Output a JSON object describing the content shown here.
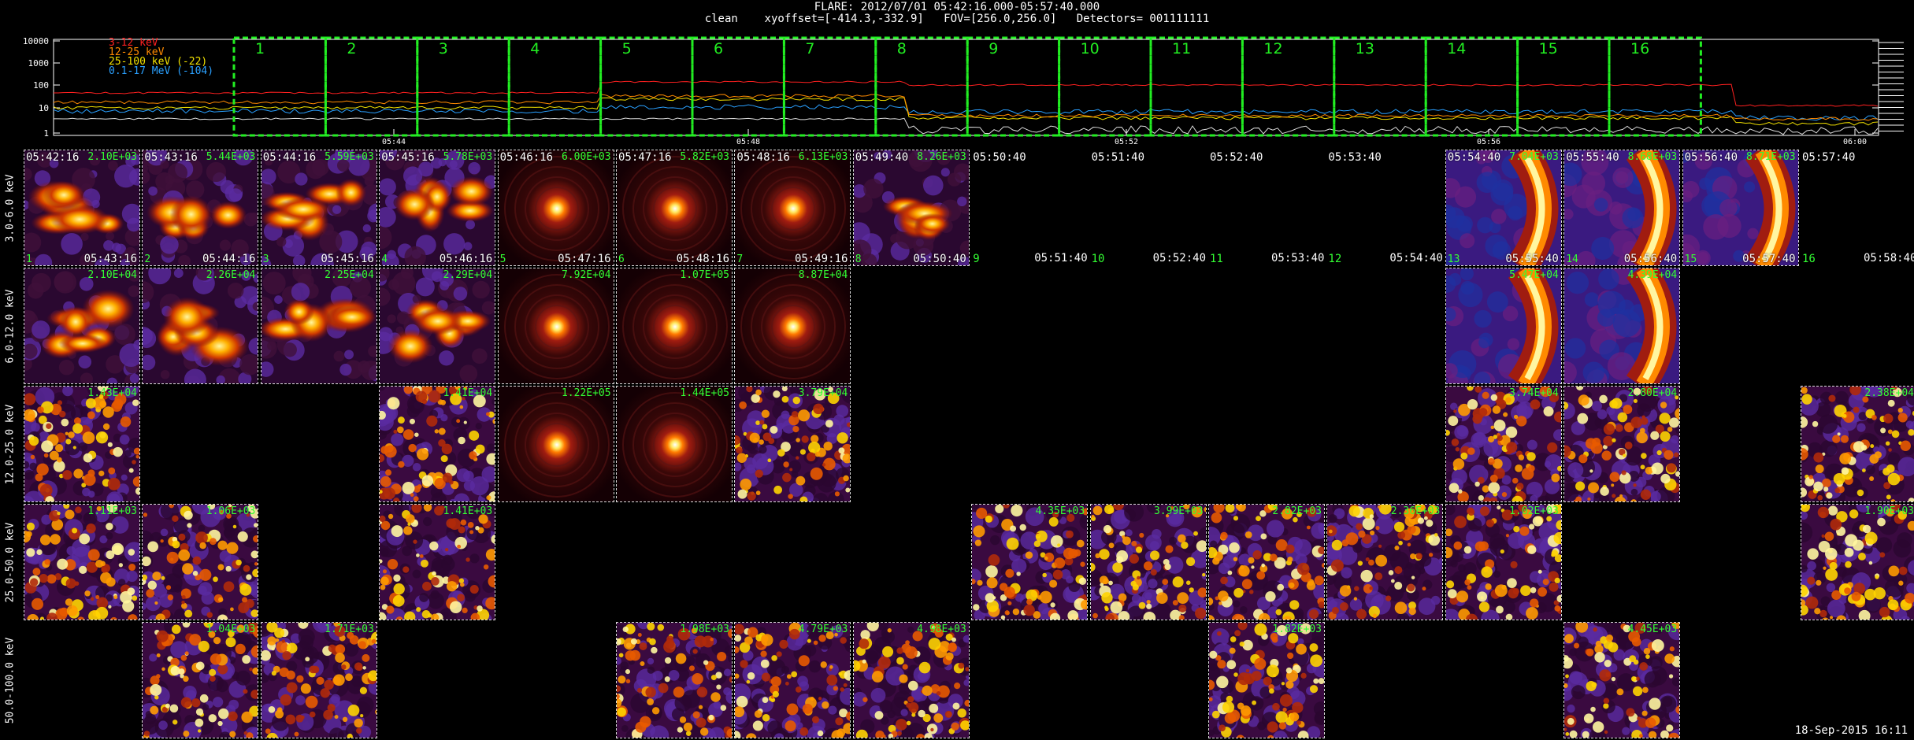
{
  "header": {
    "line1": "FLARE: 2012/07/01 05:42:16.000-05:57:40.000",
    "line2": "clean    xyoffset=[-414.3,-332.9]   FOV=[256.0,256.0]   Detectors= 001111111"
  },
  "lightcurve": {
    "y_ticks": [
      "10000",
      "1000",
      "100",
      "10",
      "1"
    ],
    "x_ticks": [
      "05:44",
      "05:48",
      "05:52",
      "05:56",
      "06:00"
    ],
    "legend": [
      {
        "label": "3-12 keV",
        "color": "#ff2020"
      },
      {
        "label": "12-25 keV",
        "color": "#ff8a00"
      },
      {
        "label": "25-100 keV (-22)",
        "color": "#f0e000"
      },
      {
        "label": "0.1-17 MeV (-104)",
        "color": "#2aa0ff"
      }
    ],
    "time_bins": [
      "1",
      "2",
      "3",
      "4",
      "5",
      "6",
      "7",
      "8",
      "9",
      "10",
      "11",
      "12",
      "13",
      "14",
      "15",
      "16"
    ],
    "bin_color": "#22ee22"
  },
  "energy_bands": [
    "3.0-6.0 keV",
    "6.0-12.0 keV",
    "12.0-25.0 keV",
    "25.0-50.0 keV",
    "50.0-100.0 keV"
  ],
  "row0_times": [
    {
      "start": "05:42:16",
      "end": "05:43:16",
      "gnum": "1"
    },
    {
      "start": "05:43:16",
      "end": "05:44:16",
      "gnum": "2"
    },
    {
      "start": "05:44:16",
      "end": "05:45:16",
      "gnum": "3"
    },
    {
      "start": "05:45:16",
      "end": "05:46:16",
      "gnum": "4"
    },
    {
      "start": "05:46:16",
      "end": "05:47:16",
      "gnum": "5"
    },
    {
      "start": "05:47:16",
      "end": "05:48:16",
      "gnum": "6"
    },
    {
      "start": "05:48:16",
      "end": "05:49:16",
      "gnum": "7"
    },
    {
      "start": "05:49:40",
      "end": "05:50:40",
      "gnum": "8"
    },
    {
      "start": "05:50:40",
      "end": "05:51:40",
      "gnum": "9"
    },
    {
      "start": "05:51:40",
      "end": "05:52:40",
      "gnum": "10"
    },
    {
      "start": "05:52:40",
      "end": "05:53:40",
      "gnum": "11"
    },
    {
      "start": "05:53:40",
      "end": "05:54:40",
      "gnum": "12"
    },
    {
      "start": "05:54:40",
      "end": "05:55:40",
      "gnum": "13"
    },
    {
      "start": "05:55:40",
      "end": "05:56:40",
      "gnum": "14"
    },
    {
      "start": "05:56:40",
      "end": "05:57:40",
      "gnum": "15"
    },
    {
      "start": "05:57:40",
      "end": "05:58:40",
      "gnum": "16"
    }
  ],
  "tiles": [
    {
      "row": 0,
      "col": 0,
      "kind": "blob",
      "max": "2.10E+03"
    },
    {
      "row": 0,
      "col": 1,
      "kind": "blob",
      "max": "5.44E+03"
    },
    {
      "row": 0,
      "col": 2,
      "kind": "blob",
      "max": "5.59E+03"
    },
    {
      "row": 0,
      "col": 3,
      "kind": "blob",
      "max": "5.78E+03"
    },
    {
      "row": 0,
      "col": 4,
      "kind": "point",
      "max": "6.00E+03"
    },
    {
      "row": 0,
      "col": 5,
      "kind": "point",
      "max": "5.82E+03"
    },
    {
      "row": 0,
      "col": 6,
      "kind": "point",
      "max": "6.13E+03"
    },
    {
      "row": 0,
      "col": 7,
      "kind": "blob",
      "max": "8.26E+03"
    },
    {
      "row": 0,
      "col": 12,
      "kind": "arc",
      "max": "7.04E+03"
    },
    {
      "row": 0,
      "col": 13,
      "kind": "arc",
      "max": "8.68E+03"
    },
    {
      "row": 0,
      "col": 14,
      "kind": "arc",
      "max": "8.71E+03"
    },
    {
      "row": 1,
      "col": 0,
      "kind": "blob",
      "max": "2.10E+04"
    },
    {
      "row": 1,
      "col": 1,
      "kind": "blob",
      "max": "2.26E+04"
    },
    {
      "row": 1,
      "col": 2,
      "kind": "blob",
      "max": "2.25E+04"
    },
    {
      "row": 1,
      "col": 3,
      "kind": "blob",
      "max": "2.29E+04"
    },
    {
      "row": 1,
      "col": 4,
      "kind": "point",
      "max": "7.92E+04"
    },
    {
      "row": 1,
      "col": 5,
      "kind": "point",
      "max": "1.07E+05"
    },
    {
      "row": 1,
      "col": 6,
      "kind": "point",
      "max": "8.87E+04"
    },
    {
      "row": 1,
      "col": 12,
      "kind": "arc",
      "max": "5.47E+04"
    },
    {
      "row": 1,
      "col": 13,
      "kind": "arc",
      "max": "4.39E+04"
    },
    {
      "row": 2,
      "col": 0,
      "kind": "noise",
      "max": "1.43E+04"
    },
    {
      "row": 2,
      "col": 3,
      "kind": "noise",
      "max": "1.41E+04"
    },
    {
      "row": 2,
      "col": 4,
      "kind": "point",
      "max": "1.22E+05"
    },
    {
      "row": 2,
      "col": 5,
      "kind": "point",
      "max": "1.44E+05"
    },
    {
      "row": 2,
      "col": 6,
      "kind": "noise",
      "max": "3.79E+04"
    },
    {
      "row": 2,
      "col": 12,
      "kind": "noise",
      "max": "3.74E+04"
    },
    {
      "row": 2,
      "col": 13,
      "kind": "noise",
      "max": "2.80E+04"
    },
    {
      "row": 2,
      "col": 15,
      "kind": "noise",
      "max": "2.38E+04"
    },
    {
      "row": 3,
      "col": 0,
      "kind": "noise",
      "max": "1.11E+03"
    },
    {
      "row": 3,
      "col": 1,
      "kind": "noise",
      "max": "1.06E+03"
    },
    {
      "row": 3,
      "col": 3,
      "kind": "noise",
      "max": "1.41E+03"
    },
    {
      "row": 3,
      "col": 8,
      "kind": "noise",
      "max": "4.35E+03"
    },
    {
      "row": 3,
      "col": 9,
      "kind": "noise",
      "max": "3.99E+03"
    },
    {
      "row": 3,
      "col": 10,
      "kind": "noise",
      "max": "2.82E+03"
    },
    {
      "row": 3,
      "col": 11,
      "kind": "noise",
      "max": "2.36E+03"
    },
    {
      "row": 3,
      "col": 12,
      "kind": "noise",
      "max": "1.02E+03"
    },
    {
      "row": 3,
      "col": 15,
      "kind": "noise",
      "max": "1.90E+03"
    },
    {
      "row": 4,
      "col": 1,
      "kind": "noise",
      "max": "1.04E+03"
    },
    {
      "row": 4,
      "col": 2,
      "kind": "noise",
      "max": "1.71E+03"
    },
    {
      "row": 4,
      "col": 5,
      "kind": "noise",
      "max": "1.98E+03"
    },
    {
      "row": 4,
      "col": 6,
      "kind": "noise",
      "max": "4.79E+03"
    },
    {
      "row": 4,
      "col": 7,
      "kind": "noise",
      "max": "4.98E+03"
    },
    {
      "row": 4,
      "col": 10,
      "kind": "noise",
      "max": "1.82E+03"
    },
    {
      "row": 4,
      "col": 13,
      "kind": "noise",
      "max": "4.45E+03"
    }
  ],
  "footer": {
    "timestamp": "18-Sep-2015 16:11"
  }
}
